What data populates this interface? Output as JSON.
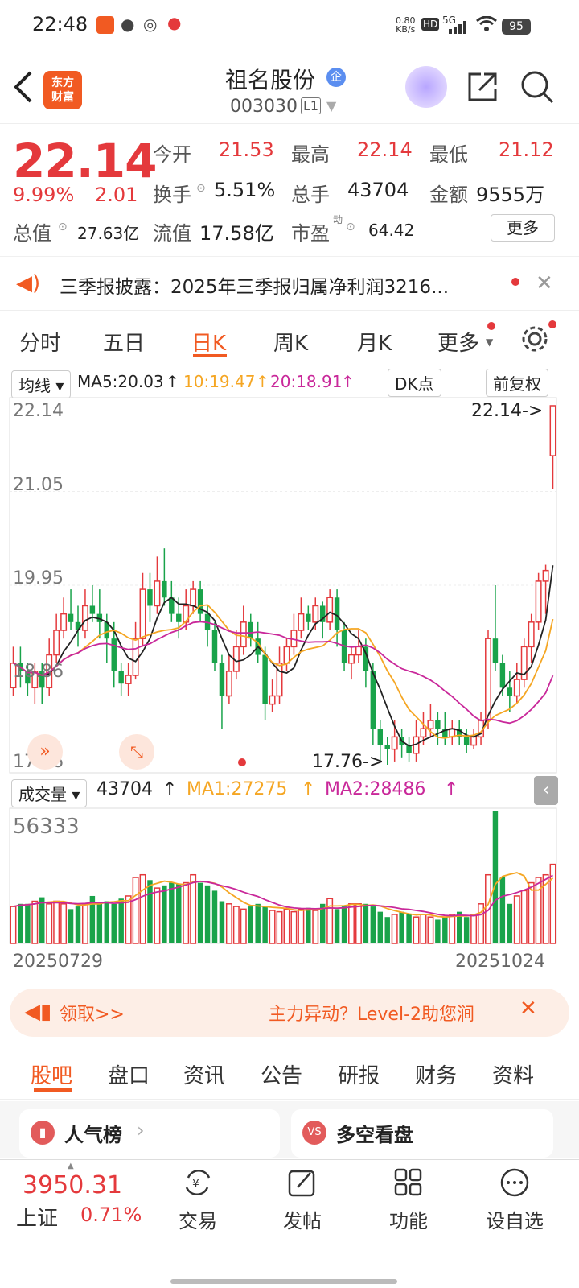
{
  "status_bar": {
    "time": "22:48",
    "net_speed": "0.80",
    "net_unit": "KB/s",
    "hd": "HD",
    "network": "5G",
    "battery": "95"
  },
  "header": {
    "logo_text": "东方\n财富",
    "stock_name": "祖名股份",
    "badge": "企",
    "stock_code": "003030",
    "level": "L1"
  },
  "quote": {
    "price": "22.14",
    "change_pct": "9.99%",
    "change": "2.01",
    "open_label": "今开",
    "open": "21.53",
    "high_label": "最高",
    "high": "22.14",
    "low_label": "最低",
    "low": "21.12",
    "turnover_label": "换手",
    "turnover": "5.51%",
    "volume_label": "总手",
    "volume": "43704",
    "amount_label": "金额",
    "amount": "9555万",
    "mktcap_label": "总值",
    "mktcap": "27.63亿",
    "float_label": "流值",
    "float": "17.58亿",
    "pe_label": "市盈",
    "pe_sup": "动",
    "pe": "64.42",
    "more_button": "更多"
  },
  "notice": {
    "text": "三季报披露：2025年三季报归属净利润3216..."
  },
  "chart_tabs": [
    "分时",
    "五日",
    "日K",
    "周K",
    "月K",
    "更多"
  ],
  "chart_tab_active": 2,
  "kline_bar": {
    "indicator": "均线",
    "ma5": "MA5:20.03",
    "ma10": "10:19.47",
    "ma20": "20:18.91",
    "dk": "DK点",
    "adjust": "前复权"
  },
  "kline": {
    "y_labels": [
      "22.14",
      "21.05",
      "19.95",
      "18.86",
      "17.76"
    ],
    "high_marker": "22.14->",
    "low_marker": "17.76->"
  },
  "volume_bar": {
    "indicator": "成交量",
    "value": "43704",
    "ma1": "MA1:27275",
    "ma2": "MA2:28486",
    "max_label": "56333"
  },
  "dates": {
    "start": "20250729",
    "end": "20251024"
  },
  "ad": {
    "left": "领取>>",
    "right": "主力异动？Level-2助您涧"
  },
  "sub_tabs": [
    "股吧",
    "盘口",
    "资讯",
    "公告",
    "研报",
    "财务",
    "资料"
  ],
  "cards": {
    "left": "人气榜",
    "right": "多空看盘"
  },
  "bottom_nav": {
    "index_value": "3950.31",
    "index_name": "上证",
    "index_change": "0.71%",
    "items": [
      "交易",
      "发帖",
      "功能",
      "设自选"
    ]
  },
  "colors": {
    "up": "#e4393c",
    "down": "#19a34a",
    "ma5": "#222222",
    "ma10": "#f5a623",
    "ma20": "#c9289a",
    "accent": "#f15a22"
  },
  "chart_data": {
    "type": "candlestick",
    "y_range": [
      17.76,
      22.14
    ],
    "candles": [
      [
        18.7,
        19.0,
        19.2,
        18.6
      ],
      [
        19.0,
        18.9,
        19.2,
        18.7
      ],
      [
        18.9,
        18.75,
        19.0,
        18.6
      ],
      [
        18.7,
        18.9,
        19.0,
        18.5
      ],
      [
        18.9,
        18.7,
        19.0,
        18.5
      ],
      [
        18.7,
        19.1,
        19.3,
        18.6
      ],
      [
        19.1,
        19.4,
        19.6,
        19.0
      ],
      [
        19.4,
        19.6,
        19.8,
        19.3
      ],
      [
        19.6,
        19.5,
        19.9,
        19.4
      ],
      [
        19.5,
        19.4,
        19.7,
        19.2
      ],
      [
        19.4,
        19.7,
        19.9,
        19.3
      ],
      [
        19.7,
        19.6,
        19.95,
        19.5
      ],
      [
        19.6,
        19.5,
        19.9,
        19.3
      ],
      [
        19.5,
        19.3,
        19.6,
        19.0
      ],
      [
        19.3,
        18.9,
        19.5,
        18.7
      ],
      [
        18.9,
        18.75,
        19.0,
        18.6
      ],
      [
        18.75,
        18.85,
        19.0,
        18.6
      ],
      [
        18.85,
        19.3,
        19.5,
        18.8
      ],
      [
        19.3,
        19.9,
        20.1,
        19.2
      ],
      [
        19.9,
        19.7,
        20.1,
        19.5
      ],
      [
        19.7,
        20.0,
        20.3,
        19.6
      ],
      [
        20.0,
        19.8,
        20.4,
        19.7
      ],
      [
        19.8,
        19.6,
        20.0,
        19.5
      ],
      [
        19.6,
        19.5,
        19.8,
        19.3
      ],
      [
        19.5,
        19.7,
        19.9,
        19.4
      ],
      [
        19.7,
        19.9,
        20.0,
        19.6
      ],
      [
        19.9,
        19.6,
        20.0,
        19.5
      ],
      [
        19.6,
        19.4,
        19.7,
        19.2
      ],
      [
        19.4,
        19.0,
        19.5,
        18.9
      ],
      [
        19.0,
        18.6,
        19.1,
        18.2
      ],
      [
        18.6,
        18.9,
        19.1,
        18.5
      ],
      [
        18.9,
        19.2,
        19.4,
        18.8
      ],
      [
        19.2,
        19.5,
        19.7,
        19.1
      ],
      [
        19.5,
        19.3,
        19.6,
        19.2
      ],
      [
        19.3,
        19.1,
        19.5,
        19.0
      ],
      [
        19.1,
        18.5,
        19.2,
        18.3
      ],
      [
        18.5,
        18.6,
        18.8,
        18.4
      ],
      [
        18.6,
        19.0,
        19.2,
        18.5
      ],
      [
        19.0,
        19.2,
        19.3,
        18.9
      ],
      [
        19.2,
        19.4,
        19.6,
        19.1
      ],
      [
        19.4,
        19.6,
        19.8,
        19.3
      ],
      [
        19.6,
        19.5,
        19.7,
        19.4
      ],
      [
        19.5,
        19.7,
        19.8,
        19.4
      ],
      [
        19.7,
        19.5,
        19.75,
        19.3
      ],
      [
        19.5,
        19.8,
        19.9,
        19.4
      ],
      [
        19.8,
        19.4,
        19.9,
        19.2
      ],
      [
        19.4,
        19.0,
        19.5,
        18.9
      ],
      [
        19.0,
        19.1,
        19.2,
        18.8
      ],
      [
        19.1,
        19.2,
        19.4,
        19.0
      ],
      [
        19.2,
        18.9,
        19.3,
        18.7
      ],
      [
        18.9,
        18.2,
        19.0,
        18.0
      ],
      [
        18.2,
        18.0,
        18.3,
        17.8
      ],
      [
        18.0,
        17.95,
        18.1,
        17.76
      ],
      [
        17.95,
        18.1,
        18.3,
        17.8
      ],
      [
        18.1,
        18.0,
        18.2,
        17.85
      ],
      [
        18.0,
        17.9,
        18.1,
        17.8
      ],
      [
        17.9,
        18.1,
        18.3,
        17.8
      ],
      [
        18.1,
        18.2,
        18.4,
        18.0
      ],
      [
        18.2,
        18.3,
        18.5,
        18.1
      ],
      [
        18.3,
        18.2,
        18.4,
        18.0
      ],
      [
        18.2,
        18.1,
        18.4,
        18.0
      ],
      [
        18.1,
        18.2,
        18.3,
        18.0
      ],
      [
        18.2,
        18.1,
        18.3,
        18.0
      ],
      [
        18.1,
        18.0,
        18.2,
        17.9
      ],
      [
        18.0,
        18.1,
        18.2,
        17.95
      ],
      [
        18.1,
        18.3,
        18.4,
        18.0
      ],
      [
        18.3,
        19.3,
        19.4,
        18.2
      ],
      [
        19.3,
        19.0,
        19.95,
        18.9
      ],
      [
        19.0,
        18.7,
        19.1,
        18.6
      ],
      [
        18.7,
        18.6,
        18.9,
        18.4
      ],
      [
        18.6,
        18.8,
        19.0,
        18.5
      ],
      [
        18.8,
        19.2,
        19.3,
        18.7
      ],
      [
        19.2,
        19.5,
        19.6,
        19.0
      ],
      [
        19.5,
        20.0,
        20.1,
        19.4
      ],
      [
        20.0,
        20.13,
        20.2,
        19.6
      ],
      [
        21.53,
        22.14,
        22.14,
        21.12
      ]
    ],
    "volumes": [
      0.28,
      0.3,
      0.3,
      0.32,
      0.35,
      0.3,
      0.32,
      0.3,
      0.26,
      0.28,
      0.3,
      0.36,
      0.3,
      0.32,
      0.3,
      0.34,
      0.36,
      0.5,
      0.52,
      0.48,
      0.42,
      0.44,
      0.46,
      0.45,
      0.46,
      0.52,
      0.46,
      0.44,
      0.4,
      0.32,
      0.3,
      0.28,
      0.26,
      0.28,
      0.3,
      0.28,
      0.25,
      0.24,
      0.26,
      0.24,
      0.26,
      0.27,
      0.25,
      0.3,
      0.34,
      0.26,
      0.28,
      0.3,
      0.3,
      0.3,
      0.28,
      0.24,
      0.2,
      0.22,
      0.24,
      0.22,
      0.2,
      0.22,
      0.2,
      0.18,
      0.2,
      0.22,
      0.24,
      0.2,
      0.22,
      0.3,
      0.52,
      1.0,
      0.5,
      0.3,
      0.36,
      0.4,
      0.46,
      0.5,
      0.52,
      0.6
    ],
    "volume_max": 56333
  }
}
